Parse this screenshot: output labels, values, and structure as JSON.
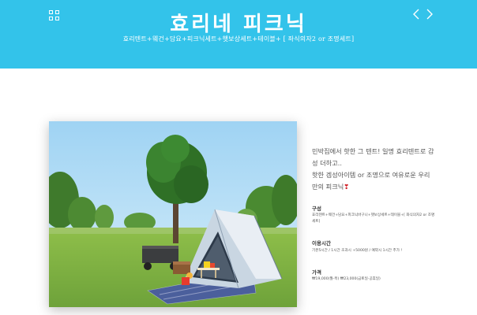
{
  "header": {
    "title": "효리네 피크닉",
    "subtitle": "효리텐트+웨건+담요+피크닉세트+햇보상세트+테이블+ [ 좌식의자2 or 조명세트]",
    "background_color": "#33c3ea",
    "menu_icon": "grid-icon",
    "prev_icon": "chevron-left-icon",
    "next_icon": "chevron-right-icon"
  },
  "photo": {
    "subject": "tent-picnic-photo"
  },
  "description": {
    "line1": "민박집에서 핫한 그 텐트! 일명 효리텐트로 감",
    "line2": "성 더하고..",
    "line3": "핫한 겜성아이템 or 조명으로 여유로운 우리",
    "line4": "만의 피크닉",
    "heart": "❣"
  },
  "sections": {
    "composition_label": "구성",
    "composition_line1": "효리텐트+웨건+담요+피크닉바구니+햇보상세트+테이블+[ 좌식의자2 or 조명",
    "composition_line2": "세트]",
    "time_label": "이용시간",
    "time_text": "기본5시간 / 1시간 초과시 +5000원 / 예약시 1시간 추가 !",
    "price_label": "가격",
    "price_text": "₩19,000(월-목) ₩23,000(금토일·공휴일)"
  }
}
